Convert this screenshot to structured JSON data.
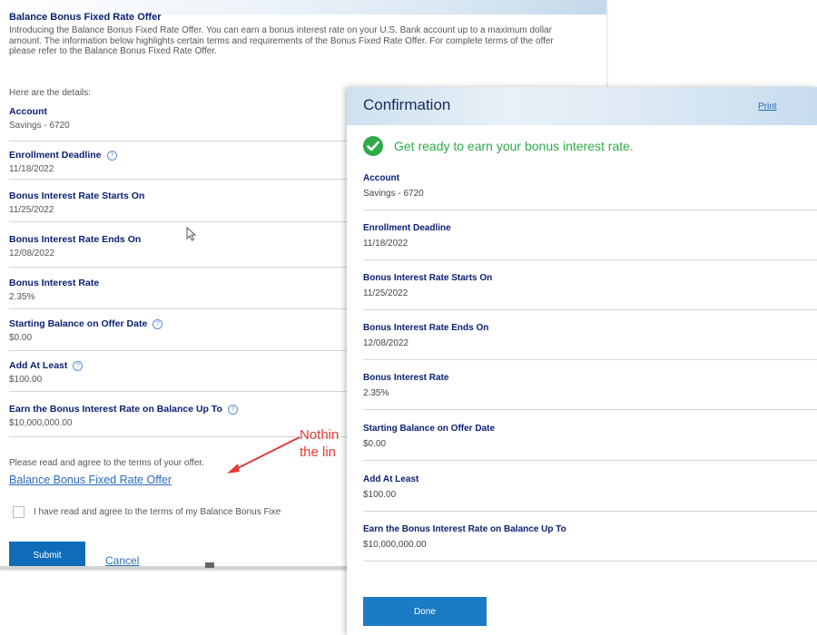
{
  "offer": {
    "title": "Balance Bonus Fixed Rate Offer",
    "intro": "Introducing the Balance Bonus Fixed Rate Offer. You can earn a bonus interest rate on your U.S. Bank account up to a maximum dollar amount. The information below highlights certain terms and requirements of the Bonus Fixed Rate Offer. For complete terms of the offer please refer to the Balance Bonus Fixed Rate Offer.",
    "details_label": "Here are the details:",
    "fields": [
      {
        "label": "Account",
        "value": "Savings - 6720"
      },
      {
        "label": "Enrollment Deadline",
        "value": "11/18/2022"
      },
      {
        "label": "Bonus Interest Rate Starts On",
        "value": "11/25/2022"
      },
      {
        "label": "Bonus Interest Rate Ends On",
        "value": "12/08/2022"
      },
      {
        "label": "Bonus Interest Rate",
        "value": "2.35%"
      },
      {
        "label": "Starting Balance on Offer Date",
        "value": "$0.00"
      },
      {
        "label": "Add At Least",
        "value": "$100.00"
      },
      {
        "label": "Earn the Bonus Interest Rate on Balance Up To",
        "value": "$10,000,000.00"
      }
    ],
    "agree_text": "Please read and agree to the terms of your offer.",
    "offer_link": "Balance Bonus Fixed Rate Offer",
    "checkbox_label": "I have read and agree to the terms of my Balance Bonus Fixe",
    "submit_label": "Submit",
    "cancel_label": "Cancel",
    "help_glyph": "?"
  },
  "annotation": {
    "line1": "Nothin",
    "line2": "the lin",
    "color": "#e53b3b"
  },
  "confirmation": {
    "title": "Confirmation",
    "print_label": "Print",
    "success_message": "Get ready to earn your bonus interest rate.",
    "fields": [
      {
        "label": "Account",
        "value": "Savings - 6720"
      },
      {
        "label": "Enrollment Deadline",
        "value": "11/18/2022"
      },
      {
        "label": "Bonus Interest Rate Starts On",
        "value": "11/25/2022"
      },
      {
        "label": "Bonus Interest Rate Ends On",
        "value": "12/08/2022"
      },
      {
        "label": "Bonus Interest Rate",
        "value": "2.35%"
      },
      {
        "label": "Starting Balance on Offer Date",
        "value": "$0.00"
      },
      {
        "label": "Add At Least",
        "value": "$100.00"
      },
      {
        "label": "Earn the Bonus Interest Rate on Balance Up To",
        "value": "$10,000,000.00"
      }
    ],
    "done_label": "Done",
    "success_color": "#2eaa4a",
    "button_color": "#1b7bc4"
  }
}
